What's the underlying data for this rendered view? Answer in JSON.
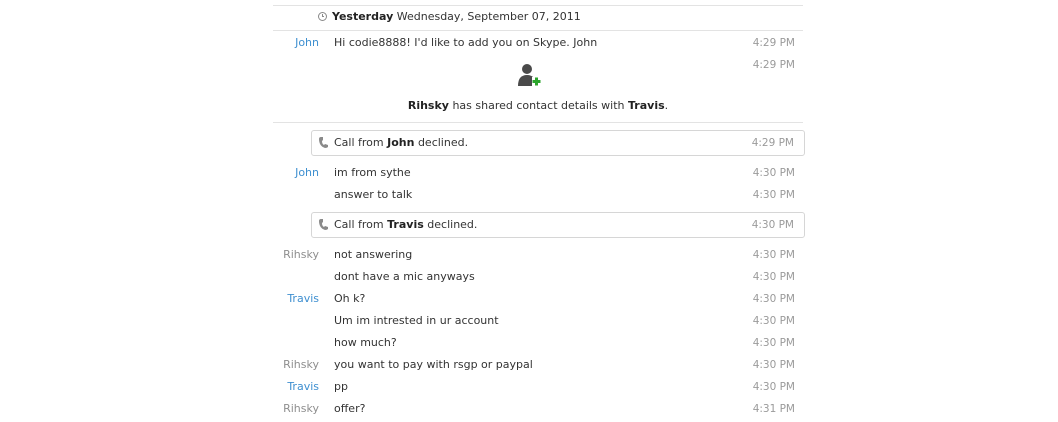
{
  "date_header": {
    "day": "Yesterday",
    "date": "Wednesday, September 07, 2011"
  },
  "messages": [
    {
      "sender": "John",
      "text": "Hi codie8888! I'd like to add you on Skype. John",
      "time": "4:29 PM"
    },
    {
      "sender": "",
      "text": "",
      "time": "4:29 PM"
    }
  ],
  "contact_share": {
    "from": "Rihsky",
    "middle": " has shared contact details with ",
    "to": "Travis",
    "end": "."
  },
  "call1": {
    "prefix": "Call from ",
    "name": "John",
    "suffix": " declined.",
    "time": "4:29 PM"
  },
  "messages2": [
    {
      "sender": "John",
      "text": "im from sythe",
      "time": "4:30 PM"
    },
    {
      "sender": "",
      "text": "answer to talk",
      "time": "4:30 PM"
    }
  ],
  "call2": {
    "prefix": "Call from ",
    "name": "Travis",
    "suffix": " declined.",
    "time": "4:30 PM"
  },
  "messages3": [
    {
      "sender": "Rihsky",
      "text": "not answering",
      "time": "4:30 PM"
    },
    {
      "sender": "",
      "text": "dont have a mic anyways",
      "time": "4:30 PM"
    },
    {
      "sender": "Travis",
      "text": "Oh k?",
      "time": "4:30 PM"
    },
    {
      "sender": "",
      "text": "Um im intrested in ur account",
      "time": "4:30 PM"
    },
    {
      "sender": "",
      "text": "how much?",
      "time": "4:30 PM"
    },
    {
      "sender": "Rihsky",
      "text": "you want to pay with rsgp or paypal",
      "time": "4:30 PM"
    },
    {
      "sender": "Travis",
      "text": "pp",
      "time": "4:30 PM"
    },
    {
      "sender": "Rihsky",
      "text": "offer?",
      "time": "4:31 PM"
    }
  ],
  "colors": {
    "sender_other": "#3e8fd0",
    "sender_self": "#8e8e8e",
    "timestamp": "#9a9a9a",
    "contact_plus": "#2ca52c"
  },
  "icons": {
    "date": "clock-icon",
    "contact": "add-contact-icon",
    "call": "phone-icon"
  }
}
